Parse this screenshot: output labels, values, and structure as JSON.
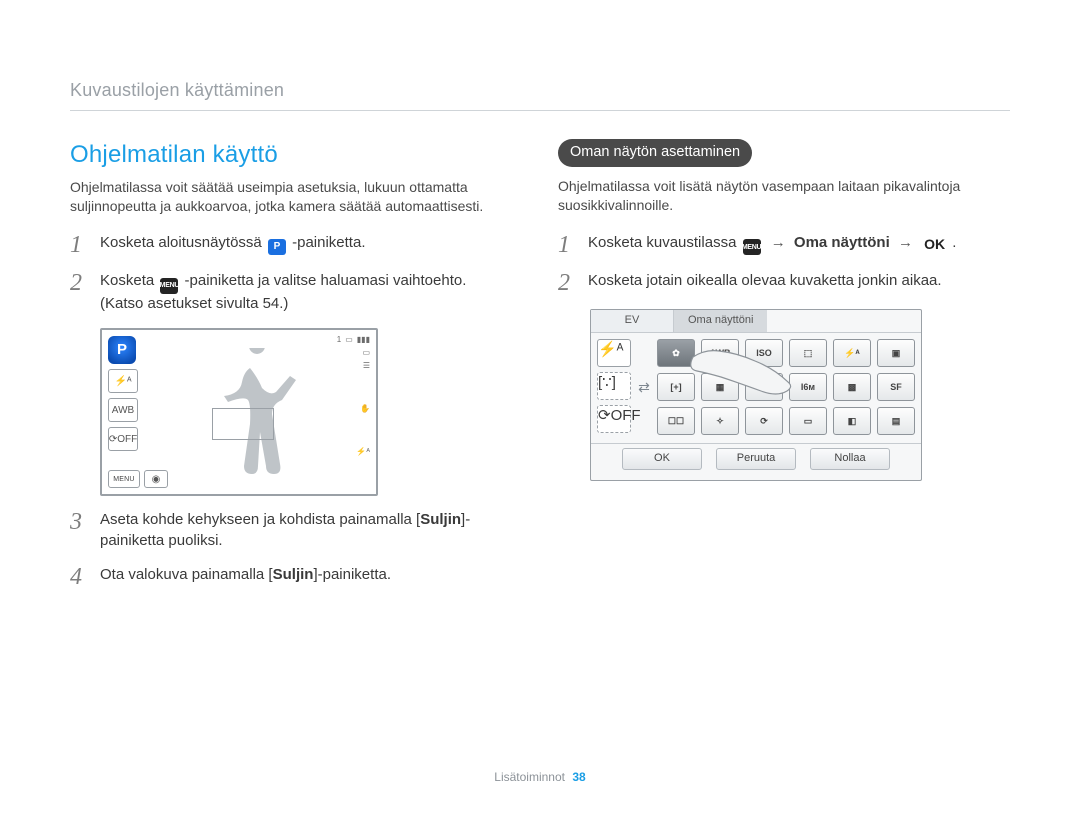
{
  "breadcrumb": "Kuvaustilojen käyttäminen",
  "left": {
    "title": "Ohjelmatilan käyttö",
    "lead": "Ohjelmatilassa voit säätää useimpia asetuksia, lukuun ottamatta suljinnopeutta ja aukkoarvoa, jotka kamera säätää automaattisesti.",
    "step1_a": "Kosketa aloitusnäytössä ",
    "step1_b": "-painiketta.",
    "step2_a": "Kosketa ",
    "step2_b": "-painiketta ja valitse haluamasi vaihtoehto. (Katso asetukset sivulta 54.)",
    "step3_a": "Aseta kohde kehykseen ja kohdista painamalla [",
    "step3_b": "Suljin",
    "step3_c": "]-painiketta puoliksi.",
    "step4_a": "Ota valokuva painamalla [",
    "step4_b": "Suljin",
    "step4_c": "]-painiketta.",
    "lcd": {
      "top_count": "1",
      "menu_label": "MENU",
      "icons_left": [
        "P",
        "⚡ᴬ",
        "AWB",
        "⟳OFF"
      ],
      "icons_right": [
        "▭",
        "☰",
        "✋",
        "⚡ᴬ"
      ]
    }
  },
  "right": {
    "pill": "Oman näytön asettaminen",
    "lead": "Ohjelmatilassa voit lisätä näytön vasempaan laitaan pikavalintoja suosikkivalinnoille.",
    "step1_a": "Kosketa kuvaustilassa ",
    "step1_arrow": "→",
    "step1_b": " Oma näyttöni ",
    "step1_c": ".",
    "step2": "Kosketa jotain oikealla olevaa kuvaketta jonkin aikaa.",
    "panel": {
      "tab_ev": "EV",
      "tab_title": "Oma näyttöni",
      "dock": [
        "⚡ᴬ",
        "[∵]",
        "⟳OFF"
      ],
      "grid": [
        "✿",
        "AWB",
        "ISO",
        "⬚",
        "⚡ᴬ",
        "▣",
        "[+]",
        "▦",
        "✲",
        "I6м",
        "▩",
        "SF",
        "☐☐",
        "✧",
        "⟳",
        "▭",
        "◧",
        "▤"
      ],
      "footer": {
        "ok": "OK",
        "cancel": "Peruuta",
        "reset": "Nollaa"
      }
    }
  },
  "inline_icons": {
    "p_label": "P",
    "menu_label": "MENU",
    "ok_label": "OK"
  },
  "footer": {
    "section": "Lisätoiminnot",
    "page": "38"
  }
}
